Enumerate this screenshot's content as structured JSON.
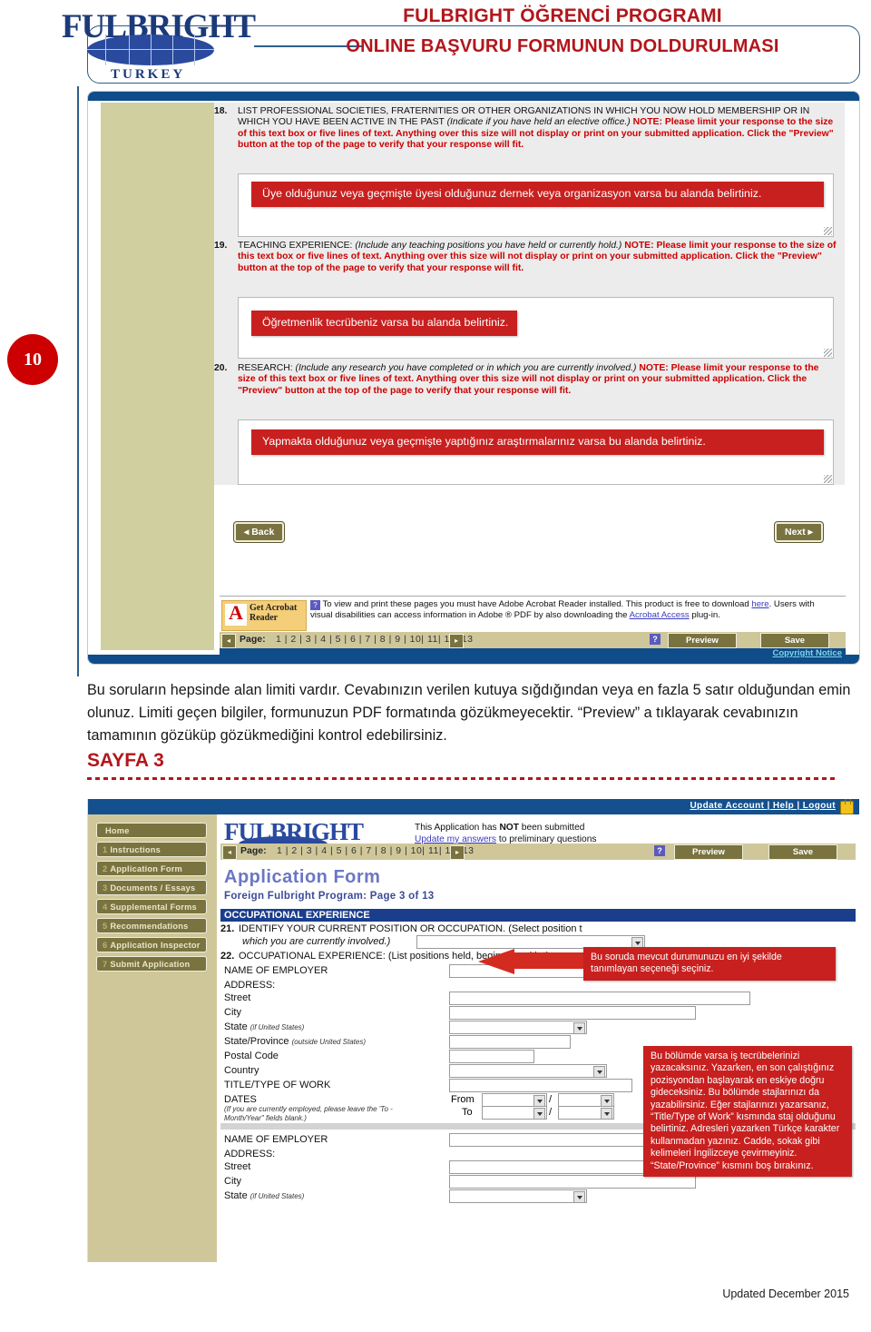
{
  "header": {
    "logo_word": "FULBRIGHT",
    "logo_country": "TURKEY",
    "title_line1": "FULBRIGHT ÖĞRENCİ PROGRAMI",
    "title_line2": "ONLINE BAŞVURU FORMUNUN DOLDURULMASI",
    "accent_color": "#b2161b",
    "logo_color": "#1b3a78"
  },
  "step_badge": {
    "number": "10",
    "color": "#cc0000"
  },
  "screenshot_top": {
    "questions": [
      {
        "number": "18.",
        "heading": "LIST PROFESSIONAL SOCIETIES, FRATERNITIES OR OTHER ORGANIZATIONS IN WHICH YOU NOW HOLD MEMBERSHIP OR IN WHICH YOU HAVE BEEN ACTIVE IN THE PAST ",
        "heading_italic": "(Indicate if you have held an elective office.)",
        "note": "NOTE: Please limit your response to the size of this text box or five lines of text. Anything over this size will not display or print on your submitted application. Click the \"Preview\" button at the top of the page to verify that your response will fit.",
        "callout": "Üye olduğunuz veya geçmişte üyesi olduğunuz dernek veya organizasyon varsa bu alanda belirtiniz."
      },
      {
        "number": "19.",
        "heading": "TEACHING EXPERIENCE: ",
        "heading_italic": "(Include any teaching positions you have held or currently hold.)",
        "note": "NOTE: Please limit your response to the size of this text box or five lines of text. Anything over this size will not display or print on your submitted application. Click the \"Preview\" button at the top of the page to verify that your response will fit.",
        "callout": "Öğretmenlik tecrübeniz varsa bu alanda belirtiniz."
      },
      {
        "number": "20.",
        "heading": "RESEARCH: ",
        "heading_italic": "(Include any research you have completed or in which you are currently involved.)",
        "note": "NOTE: Please limit your response to the size of this text box or five lines of text. Anything over this size will not display or print on your submitted application. Click the \"Preview\" button at the top of the page to verify that your response will fit.",
        "callout": "Yapmakta olduğunuz veya geçmişte yaptığınız araştırmalarınız varsa bu alanda belirtiniz."
      }
    ],
    "back_button": "◂ Back",
    "next_button": "Next ▸",
    "acrobat": {
      "get_label": "Get",
      "brand_line1": "Acrobat",
      "brand_line2": "Reader",
      "adobe_label": "Adobe",
      "text_part1": "To view and print these pages you must have Adobe Acrobat Reader installed. This product is free to download ",
      "link_here": "here",
      "text_part2": ". Users with visual disabilities can access information in Adobe ® PDF by also downloading the ",
      "link_access": "Acrobat Access",
      "text_part3": " plug-in."
    },
    "pager": {
      "prev_arrow": "◂",
      "next_arrow": "▸",
      "label": "Page:",
      "numbers": "1 | 2 | 3 | 4 | 5 | 6 | 7 | 8 | 9 | 10| 11| 12| 13",
      "help_icon": "?",
      "preview_button": "Preview",
      "save_button": "Save"
    },
    "copyright": "Copyright Notice"
  },
  "paragraph": {
    "line1": "Bu soruların hepsinde alan limiti vardır. Cevabınızın verilen kutuya sığdığından veya en fazla 5 satır olduğundan emin olunuz. Limiti geçen bilgiler, formunuzun PDF formatında gözükmeyecektir. “Preview” a tıklayarak cevabınızın tamamının gözüküp gözükmediğini kontrol edebilirsiniz.",
    "section_label": "SAYFA 3"
  },
  "screenshot_bottom": {
    "topbar_links": "Update Account | Help | Logout",
    "lock_icon": "lock-icon",
    "sidebar_items": [
      {
        "num": "",
        "label": "Home"
      },
      {
        "num": "1",
        "label": "Instructions"
      },
      {
        "num": "2",
        "label": "Application Form"
      },
      {
        "num": "3",
        "label": "Documents / Essays"
      },
      {
        "num": "4",
        "label": "Supplemental Forms"
      },
      {
        "num": "5",
        "label": "Recommendations"
      },
      {
        "num": "6",
        "label": "Application Inspector"
      },
      {
        "num": "7",
        "label": "Submit Application"
      }
    ],
    "logo_word": "FULBRIGHT",
    "status_line1_pre": "This Application has ",
    "status_line1_bold": "NOT",
    "status_line1_post": " been submitted",
    "status_link": "Update my answers",
    "status_line2_post": " to preliminary questions",
    "pager": {
      "prev_arrow": "◂",
      "next_arrow": "▸",
      "label": "Page:",
      "numbers": "1 | 2 | 3 | 4 | 5 | 6 | 7 | 8 | 9 | 10| 11| 12| 13",
      "help_icon": "?",
      "preview_button": "Preview",
      "save_button": "Save"
    },
    "page_title": "Application Form",
    "page_subtitle": "Foreign Fulbright Program: Page 3 of 13",
    "section_header": "OCCUPATIONAL EXPERIENCE",
    "q21_number": "21.",
    "q21_text": "IDENTIFY YOUR CURRENT POSITION OR OCCUPATION. (Select position t",
    "q21_text2": "which you are currently involved.)",
    "q22_number": "22.",
    "q22_text": "OCCUPATIONAL EXPERIENCE: (List positions held, beginning with the mos",
    "fields": {
      "name_of_employer": "NAME OF EMPLOYER",
      "address": "ADDRESS:",
      "street": "Street",
      "city": "City",
      "state": "State",
      "state_note": "(if United States)",
      "state_province": "State/Province",
      "state_province_note": "(outside United States)",
      "postal_code": "Postal Code",
      "country": "Country",
      "title_type_of_work": "TITLE/TYPE OF WORK",
      "dates": "DATES",
      "dates_note": "(If you are currently employed, please leave the 'To - Month/Year\" fields blank.)",
      "from": "From",
      "to": "To",
      "slash": "/"
    },
    "callout_top": "Bu soruda mevcut durumunuzu en iyi şekilde tanımlayan seçeneği seçiniz.",
    "callout_side": "Bu bölümde varsa iş tecrübelerinizi yazacaksınız. Yazarken, en son çalıştığınız pozisyondan başlayarak en eskiye doğru gideceksiniz. Bu bölümde stajlarınızı da yazabilirsiniz. Eğer stajlarınızı yazarsanız, “Title/Type of Work” kısmında staj olduğunu belirtiniz. Adresleri yazarken Türkçe karakter kullanmadan yazınız. Cadde, sokak gibi kelimeleri İngilizceye çevirmeyiniz. “State/Province” kısmını boş bırakınız."
  },
  "footer": {
    "updated": "Updated December 2015"
  }
}
